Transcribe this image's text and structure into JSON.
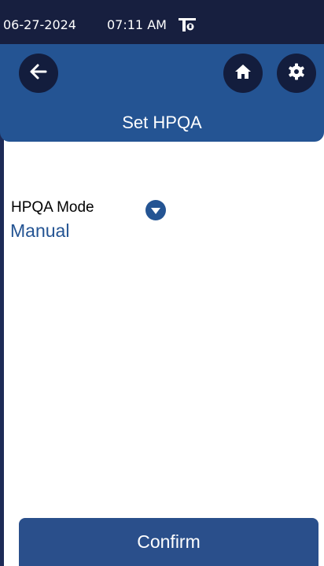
{
  "status_bar": {
    "date": "06-27-2024",
    "time": "07:11 AM",
    "icon": "tower-signal-icon"
  },
  "header": {
    "title": "Set HPQA",
    "back_icon": "arrow-left-icon",
    "home_icon": "home-icon",
    "settings_icon": "gear-icon"
  },
  "form": {
    "mode_label": "HPQA Mode",
    "mode_value": "Manual",
    "dropdown_icon": "chevron-down-icon"
  },
  "footer": {
    "confirm_label": "Confirm"
  },
  "colors": {
    "status_bar_bg": "#171f3f",
    "header_bg": "#245493",
    "icon_button_bg": "#131d3d",
    "accent_text": "#245493",
    "confirm_bg": "#2a4f8b"
  }
}
